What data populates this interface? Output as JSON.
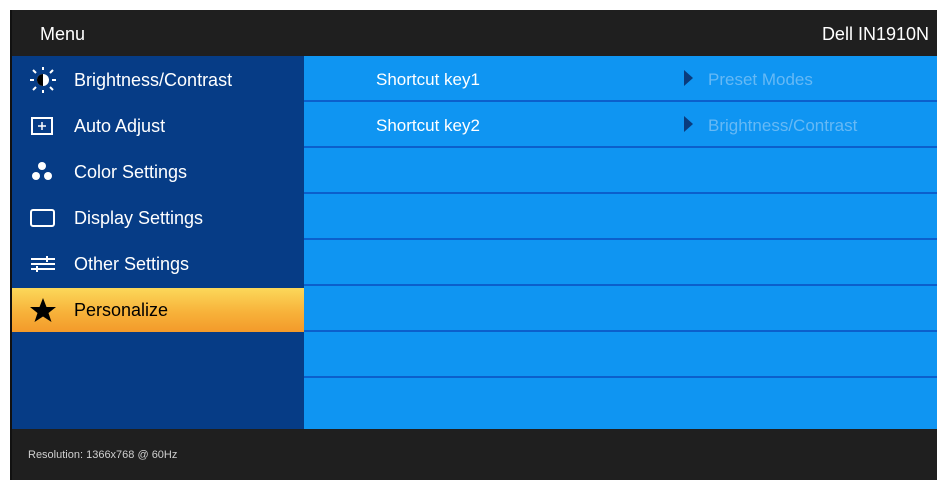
{
  "header": {
    "title": "Menu",
    "model": "Dell IN1910N"
  },
  "menu": {
    "items": [
      {
        "label": "Brightness/Contrast",
        "icon": "brightness-icon"
      },
      {
        "label": "Auto Adjust",
        "icon": "auto-adjust-icon"
      },
      {
        "label": "Color Settings",
        "icon": "color-settings-icon"
      },
      {
        "label": "Display Settings",
        "icon": "display-icon"
      },
      {
        "label": "Other Settings",
        "icon": "sliders-icon"
      },
      {
        "label": "Personalize",
        "icon": "star-icon",
        "selected": true
      }
    ]
  },
  "personalize": {
    "rows": [
      {
        "label": "Shortcut key1",
        "value": "Preset Modes"
      },
      {
        "label": "Shortcut key2",
        "value": "Brightness/Contrast"
      }
    ]
  },
  "status": {
    "resolution": "Resolution:  1366x768 @ 60Hz"
  },
  "colors": {
    "header_bg": "#1f1f1f",
    "sidebar_bg": "#063c86",
    "content_bg": "#0f95f2",
    "selected_bg": "#f7b23a"
  }
}
